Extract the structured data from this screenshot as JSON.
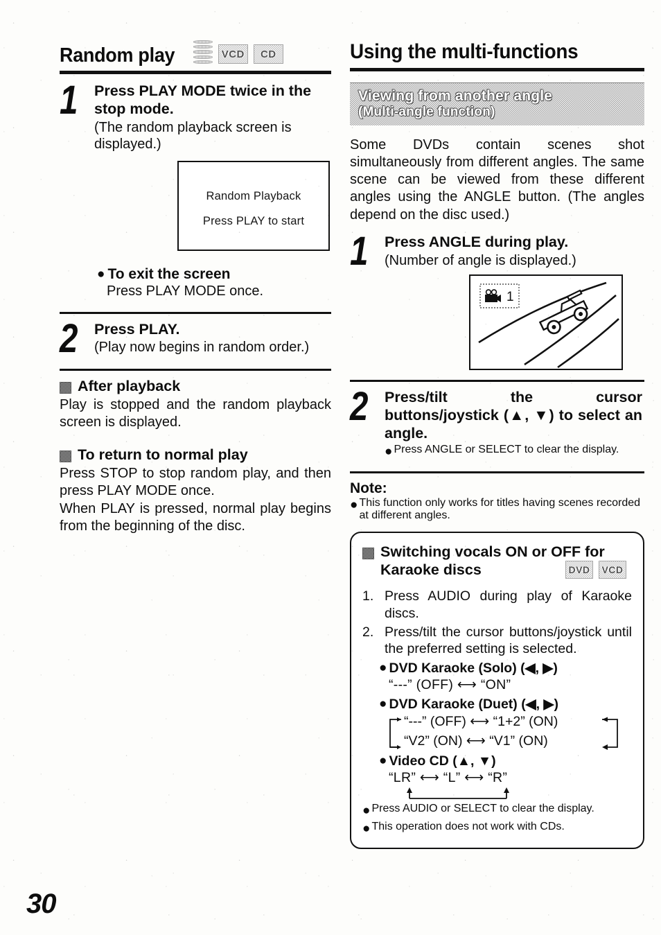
{
  "page": {
    "number": "30"
  },
  "left_column": {
    "heading": "Random play",
    "badges": [
      "disc-stack-icon",
      "VCD",
      "CD"
    ],
    "steps": [
      {
        "number": "1",
        "title": "Press PLAY MODE twice in the stop mode.",
        "sub": "(The random playback screen is displayed.)",
        "screen": {
          "line1": "Random Playback",
          "line2": "Press PLAY to start"
        },
        "after": {
          "bullet_title": "To exit the screen",
          "bullet_body": "Press PLAY MODE once."
        }
      },
      {
        "number": "2",
        "title": "Press PLAY.",
        "sub": "(Play now begins in random order.)"
      }
    ],
    "sections": [
      {
        "heading": "After playback",
        "body": "Play is stopped and the random playback screen is displayed."
      },
      {
        "heading": "To return to normal play",
        "body1": "Press STOP to stop random play, and then press PLAY MODE once.",
        "body2": "When PLAY is pressed, normal play begins from the beginning of the disc."
      }
    ]
  },
  "right_column": {
    "heading": "Using the multi-functions",
    "banner": {
      "line1": "Viewing from another angle",
      "line2": "(Multi-angle function)"
    },
    "intro": "Some DVDs contain scenes shot simultaneously from different angles. The same scene can be viewed from these different angles using the ANGLE button. (The angles depend on the disc used.)",
    "steps": [
      {
        "number": "1",
        "title": "Press ANGLE during play.",
        "sub": "(Number of angle is displayed.)",
        "illustration": {
          "icon": "movie-camera-icon",
          "angle_number": "1",
          "scene": "race-car-on-track"
        }
      },
      {
        "number": "2",
        "title": "Press/tilt the cursor buttons/joystick (▲, ▼) to select an angle.",
        "bullet": "Press ANGLE or SELECT to clear the display."
      }
    ],
    "note": {
      "label": "Note:",
      "bullet": "This function only works for titles having scenes recorded at different angles."
    },
    "karaoke_box": {
      "heading": "Switching vocals ON or OFF for Karaoke discs",
      "badges": [
        "DVD",
        "VCD"
      ],
      "steps": [
        {
          "n": "1.",
          "text": "Press AUDIO during play of Karaoke discs."
        },
        {
          "n": "2.",
          "text": "Press/tilt the cursor buttons/joystick until the preferred setting is selected."
        }
      ],
      "options": [
        {
          "title": "DVD Karaoke (Solo) (◀, ▶)",
          "type": "simple",
          "values": "“---” (OFF) ⟷ “ON”"
        },
        {
          "title": "DVD Karaoke (Duet) (◀, ▶)",
          "type": "cycle4",
          "row1": "“---” (OFF) ⟷ “1+2” (ON)",
          "row2": "“V2” (ON) ⟷ “V1” (ON)"
        },
        {
          "title": "Video CD (▲, ▼)",
          "type": "cycle3",
          "values": "“LR” ⟷ “L” ⟷ “R”"
        }
      ],
      "footer_bullets": [
        "Press AUDIO or SELECT to clear the display.",
        "This operation does not work with CDs."
      ]
    }
  }
}
